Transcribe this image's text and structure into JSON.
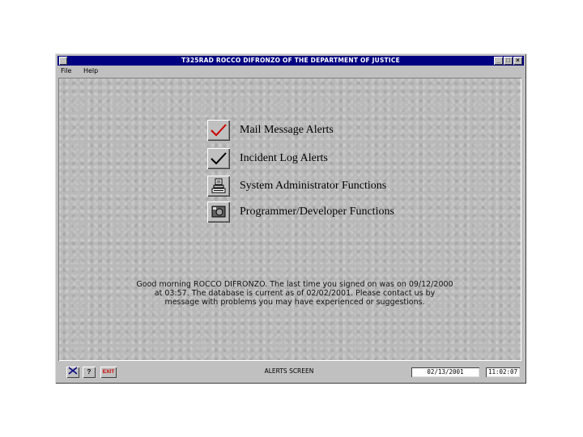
{
  "window": {
    "title": "T325RAD   ROCCO  DIFRONZO OF THE DEPARTMENT OF JUSTICE",
    "min_label": "_",
    "max_label": "□",
    "close_label": "×"
  },
  "menu": {
    "items": [
      "File",
      "Help"
    ]
  },
  "options": [
    {
      "label": "Mail Message Alerts",
      "icon": "red-check-icon"
    },
    {
      "label": "Incident Log Alerts",
      "icon": "black-check-icon"
    },
    {
      "label": "System Administrator Functions",
      "icon": "computer-icon"
    },
    {
      "label": "Programmer/Developer Functions",
      "icon": "developer-tools-icon"
    }
  ],
  "message": "Good morning ROCCO  DIFRONZO. The last time you signed on was on 09/12/2000 at 03:57. The database is current as of 02/02/2001. Please contact us by message with problems you may have experienced or suggestions.",
  "status": {
    "screen_label": "ALERTS SCREEN",
    "date": "02/13/2001",
    "time": "11:02:07",
    "help_label": "?",
    "exit_label": "EXIT"
  },
  "colors": {
    "title_bar": "#000080",
    "check_red": "#cc0000"
  }
}
